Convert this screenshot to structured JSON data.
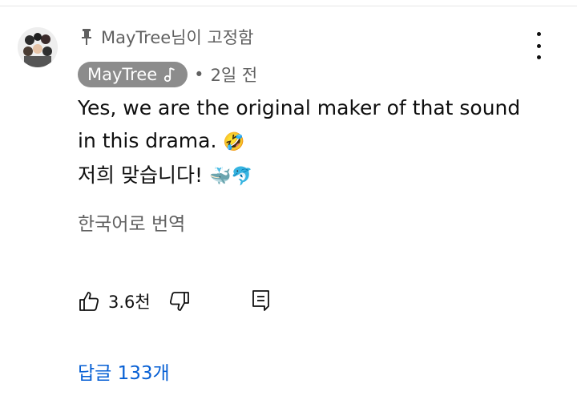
{
  "pinned_label": "MayTree님이 고정함",
  "author": {
    "name": "MayTree"
  },
  "timestamp": "2일 전",
  "comment": {
    "line1": "Yes, we are the original maker of that sound",
    "line2_text": "in this drama.",
    "line2_emoji": "🤣",
    "line3_text": "저희 맞습니다!",
    "line3_emoji": "🐳🐬"
  },
  "translate_label": "한국어로 번역",
  "likes": "3.6천",
  "replies_label": "답글 133개",
  "colors": {
    "reply_link": "#065fd4",
    "chip_bg": "#8c8c8c",
    "secondary_text": "#606060"
  }
}
